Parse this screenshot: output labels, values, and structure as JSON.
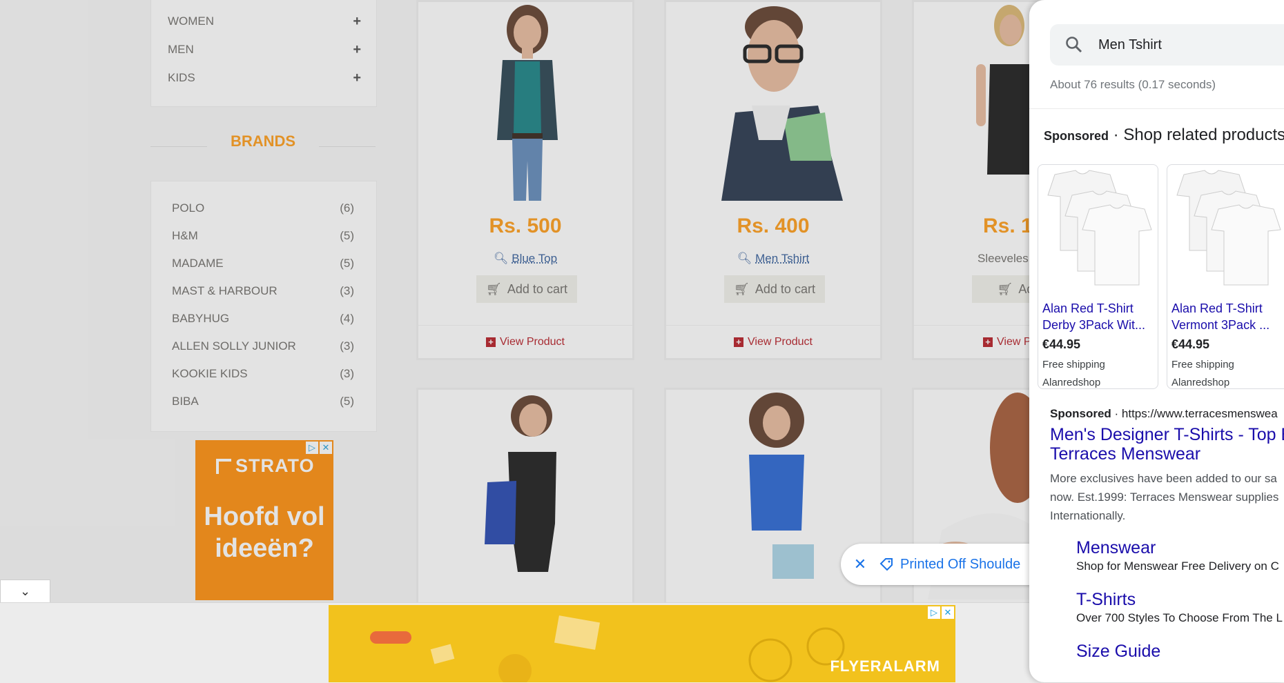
{
  "categories": [
    {
      "label": "WOMEN",
      "expand": "+"
    },
    {
      "label": "MEN",
      "expand": "+"
    },
    {
      "label": "KIDS",
      "expand": "+"
    }
  ],
  "brands_title": "BRANDS",
  "brands": [
    {
      "name": "POLO",
      "count": "(6)"
    },
    {
      "name": "H&M",
      "count": "(5)"
    },
    {
      "name": "MADAME",
      "count": "(5)"
    },
    {
      "name": "MAST & HARBOUR",
      "count": "(3)"
    },
    {
      "name": "BABYHUG",
      "count": "(4)"
    },
    {
      "name": "ALLEN SOLLY JUNIOR",
      "count": "(3)"
    },
    {
      "name": "KOOKIE KIDS",
      "count": "(3)"
    },
    {
      "name": "BIBA",
      "count": "(5)"
    }
  ],
  "ad_left": {
    "brand": "STRATO",
    "slogan": "Hoofd vol ideeën?",
    "color": "#ff8a00"
  },
  "products": [
    {
      "price": "Rs. 500",
      "name": "Blue Top",
      "cart": "Add to cart",
      "view": "View Product"
    },
    {
      "price": "Rs. 400",
      "name": "Men Tshirt",
      "cart": "Add to cart",
      "view": "View Product"
    },
    {
      "price": "Rs. 1",
      "name": "Sleeveles",
      "cart": "Add t",
      "view": "View P"
    }
  ],
  "ad_bottom": {
    "brand": "FLYERALARM",
    "color": "#f2c21d"
  },
  "chip": {
    "label": "Printed Off Shoulde"
  },
  "google": {
    "query": "Men Tshirt",
    "stats": "About 76 results (0.17 seconds)",
    "sponsored": "Sponsored",
    "shop_title": "Shop related products",
    "products": [
      {
        "title1": "Alan Red T-Shirt",
        "title2": "Derby 3Pack Wit...",
        "price": "€44.95",
        "shipping": "Free shipping",
        "shop": "Alanredshop"
      },
      {
        "title1": "Alan Red T-Shirt",
        "title2": "Vermont 3Pack ...",
        "price": "€44.95",
        "shipping": "Free shipping",
        "shop": "Alanredshop"
      }
    ],
    "ad": {
      "sponsored": "Sponsored",
      "url": "https://www.terracesmenswea",
      "title1": "Men's Designer T-Shirts - Top B",
      "title2": "Terraces Menswear",
      "desc1": "More exclusives have been added to our sa",
      "desc2": "now. Est.1999: Terraces Menswear supplies",
      "desc3": "Internationally.",
      "sitelinks": [
        {
          "title": "Menswear",
          "desc": "Shop for Menswear Free Delivery on C"
        },
        {
          "title": "T-Shirts",
          "desc": "Over 700 Styles To Choose From The L"
        },
        {
          "title": "Size Guide",
          "desc": ""
        }
      ]
    }
  },
  "colors": {
    "accent_orange": "#FE980F",
    "link_blue": "#1a0dab",
    "google_blue": "#1a73e8",
    "view_red": "#b3131b"
  }
}
